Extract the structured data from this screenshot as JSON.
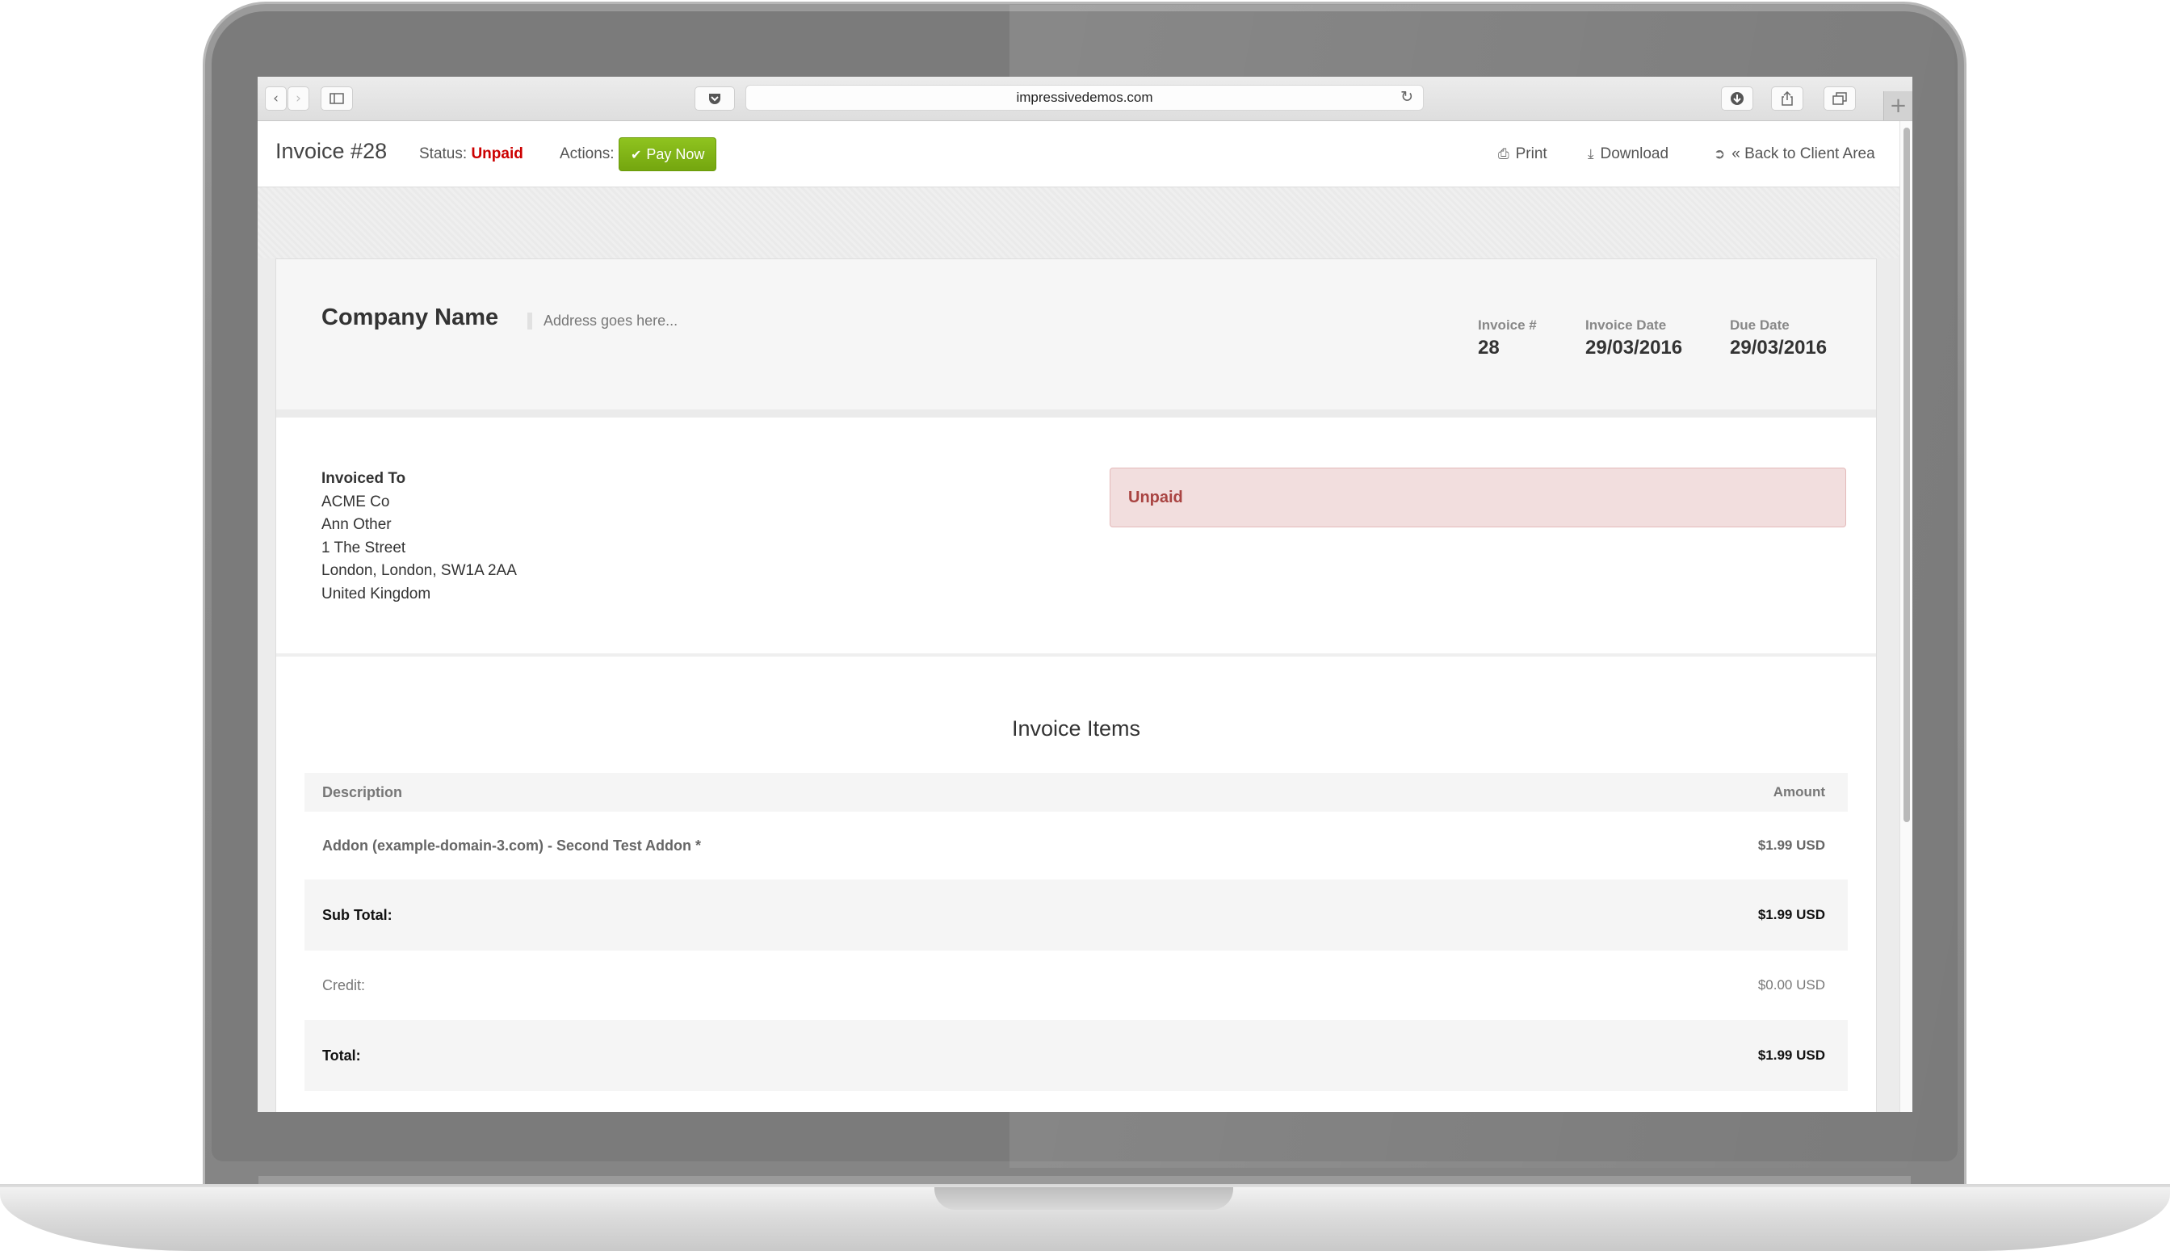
{
  "browser": {
    "url": "impressivedemos.com",
    "back_icon": "chevron-left-icon",
    "forward_icon": "chevron-right-icon",
    "sidebar_icon": "sidebar-icon",
    "pocket_icon": "pocket-icon",
    "reload_icon": "reload-icon",
    "download_icon": "download-icon",
    "share_icon": "share-icon",
    "tabs_icon": "tabs-icon",
    "new_tab_label": "+"
  },
  "header": {
    "title": "Invoice #28",
    "status_label": "Status:",
    "status_value": "Unpaid",
    "actions_label": "Actions:",
    "pay_now_label": "Pay Now",
    "print_label": "Print",
    "download_label": "Download",
    "back_label": "« Back to Client Area"
  },
  "invoice": {
    "company_name": "Company Name",
    "address": "Address goes here...",
    "number_label": "Invoice #",
    "number_value": "28",
    "date_label": "Invoice Date",
    "date_value": "29/03/2016",
    "due_label": "Due Date",
    "due_value": "29/03/2016"
  },
  "billing": {
    "heading": "Invoiced To",
    "lines": [
      "ACME Co",
      "Ann Other",
      "1 The Street",
      "London, London, SW1A 2AA",
      "United Kingdom"
    ]
  },
  "status_box": {
    "text": "Unpaid"
  },
  "items": {
    "title": "Invoice Items",
    "col_description": "Description",
    "col_amount": "Amount",
    "rows": [
      {
        "description": "Addon (example-domain-3.com) - Second Test Addon *",
        "amount": "$1.99 USD"
      }
    ],
    "sub_total_label": "Sub Total:",
    "sub_total_value": "$1.99 USD",
    "credit_label": "Credit:",
    "credit_value": "$0.00 USD",
    "total_label": "Total:",
    "total_value": "$1.99 USD"
  },
  "colors": {
    "status_unpaid": "#cc0000",
    "pay_now_bg": "#83b818",
    "alert_bg": "#f2dede",
    "alert_text": "#a94442"
  }
}
